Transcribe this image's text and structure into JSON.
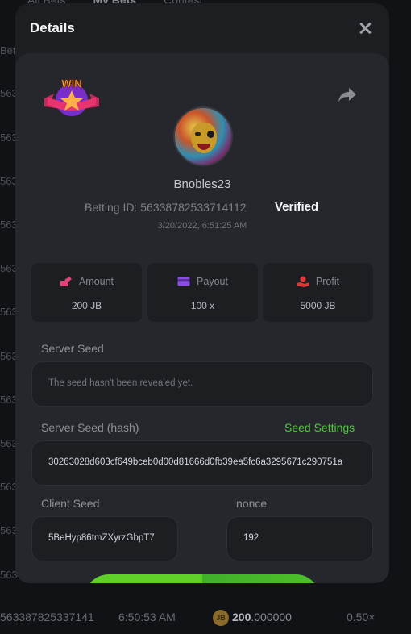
{
  "background": {
    "tabs": [
      "All Bets",
      "My Bets",
      "Contest"
    ],
    "row_ids": [
      "Bet",
      "563",
      "563",
      "563",
      "563",
      "563",
      "563",
      "563",
      "563",
      "563",
      "563",
      "563",
      "563",
      "563"
    ],
    "last_row": {
      "bet_id": "563387825337141",
      "time": "6:50:53 AM",
      "coin": "JB",
      "amount_int": "200",
      "amount_dec": ".000000",
      "multiplier": "0.50×"
    }
  },
  "modal": {
    "title": "Details",
    "close_icon": "close-icon",
    "badge": "WIN",
    "share_icon": "share-icon",
    "username": "Bnobles23",
    "betting_id_label": "Betting ID:",
    "betting_id": "56338782533714112",
    "verified": "Verified",
    "timestamp": "3/20/2022, 6:51:25 AM",
    "stats": {
      "amount": {
        "label": "Amount",
        "value": "200 JB",
        "icon": "coins-icon",
        "color": "#e0457a"
      },
      "payout": {
        "label": "Payout",
        "value": "100 x",
        "icon": "card-icon",
        "color": "#8a4fe0"
      },
      "profit": {
        "label": "Profit",
        "value": "5000 JB",
        "icon": "hand-coin-icon",
        "color": "#e0383a"
      }
    },
    "server_seed": {
      "label": "Server Seed",
      "value": "The seed hasn't been revealed yet."
    },
    "server_seed_hash": {
      "label": "Server Seed (hash)",
      "link": "Seed Settings",
      "value": "30263028d603cf649bceb0d00d81666d0fb39ea5fc6a3295671c290751a"
    },
    "client_seed": {
      "label": "Client Seed",
      "value": "5BeHyp86tmZXyrzGbpT7"
    },
    "nonce": {
      "label": "nonce",
      "value": "192"
    },
    "accent_green": "#4ec93a"
  }
}
